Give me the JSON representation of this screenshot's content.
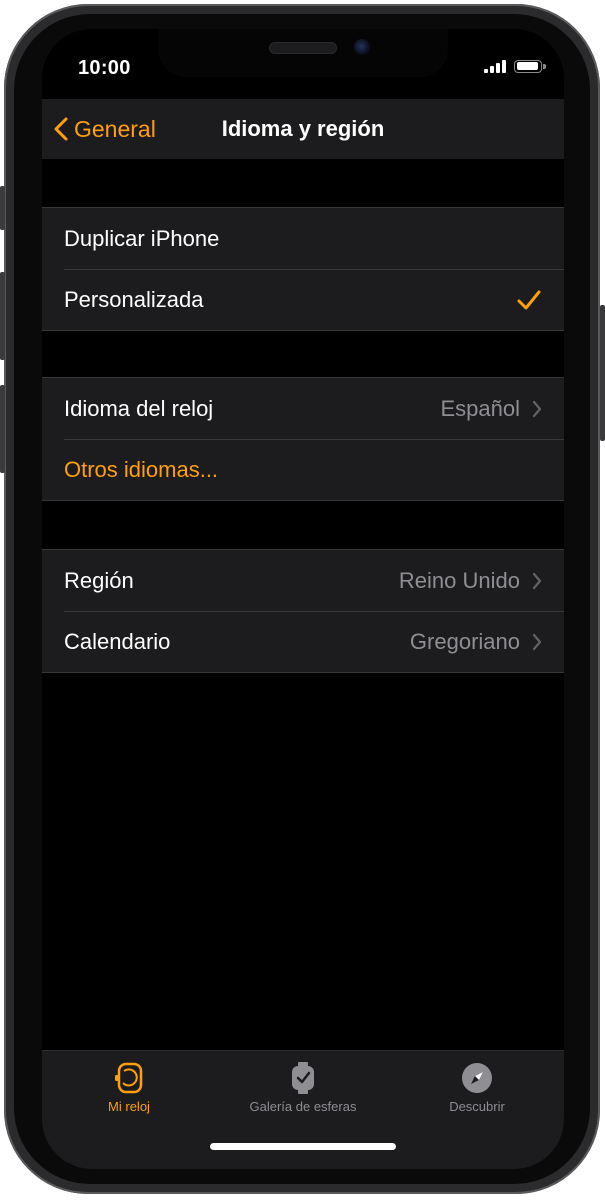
{
  "status_bar": {
    "time": "10:00"
  },
  "nav": {
    "back_label": "General",
    "title": "Idioma y región"
  },
  "section1": {
    "rows": [
      {
        "label": "Duplicar iPhone"
      },
      {
        "label": "Personalizada",
        "selected": true
      }
    ]
  },
  "section2": {
    "rows": [
      {
        "label": "Idioma del reloj",
        "value": "Español"
      },
      {
        "label": "Otros idiomas..."
      }
    ]
  },
  "section3": {
    "rows": [
      {
        "label": "Región",
        "value": "Reino Unido"
      },
      {
        "label": "Calendario",
        "value": "Gregoriano"
      }
    ]
  },
  "tab_bar": {
    "tabs": [
      {
        "label": "Mi reloj",
        "icon": "watch-icon",
        "active": true
      },
      {
        "label": "Galería de esferas",
        "icon": "watch-face-gallery-icon",
        "active": false
      },
      {
        "label": "Descubrir",
        "icon": "compass-icon",
        "active": false
      }
    ]
  },
  "colors": {
    "accent": "#ff9f0a",
    "background": "#000000",
    "cell": "#1c1c1e",
    "secondary_text": "#8e8e93"
  }
}
